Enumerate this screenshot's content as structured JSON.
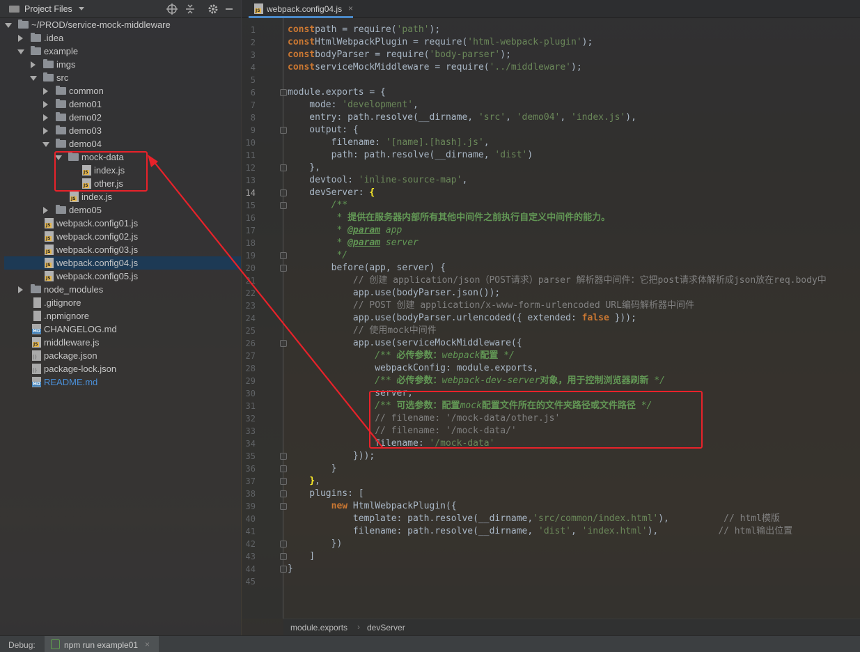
{
  "project_panel": {
    "title": "Project Files",
    "tree": [
      {
        "label": "~/PROD/service-mock-middleware",
        "type": "folder",
        "depth": 0,
        "state": "open"
      },
      {
        "label": ".idea",
        "type": "folder",
        "depth": 1,
        "state": "closed"
      },
      {
        "label": "example",
        "type": "folder",
        "depth": 1,
        "state": "open"
      },
      {
        "label": "imgs",
        "type": "folder",
        "depth": 2,
        "state": "closed"
      },
      {
        "label": "src",
        "type": "folder",
        "depth": 2,
        "state": "open"
      },
      {
        "label": "common",
        "type": "folder",
        "depth": 3,
        "state": "closed"
      },
      {
        "label": "demo01",
        "type": "folder",
        "depth": 3,
        "state": "closed"
      },
      {
        "label": "demo02",
        "type": "folder",
        "depth": 3,
        "state": "closed"
      },
      {
        "label": "demo03",
        "type": "folder",
        "depth": 3,
        "state": "closed"
      },
      {
        "label": "demo04",
        "type": "folder",
        "depth": 3,
        "state": "open"
      },
      {
        "label": "mock-data",
        "type": "folder",
        "depth": 4,
        "state": "open"
      },
      {
        "label": "index.js",
        "type": "js",
        "depth": 5
      },
      {
        "label": "other.js",
        "type": "js",
        "depth": 5
      },
      {
        "label": "index.js",
        "type": "js",
        "depth": 4
      },
      {
        "label": "demo05",
        "type": "folder",
        "depth": 3,
        "state": "closed"
      },
      {
        "label": "webpack.config01.js",
        "type": "js",
        "depth": 2
      },
      {
        "label": "webpack.config02.js",
        "type": "js",
        "depth": 2
      },
      {
        "label": "webpack.config03.js",
        "type": "js",
        "depth": 2
      },
      {
        "label": "webpack.config04.js",
        "type": "js",
        "depth": 2,
        "selected": true
      },
      {
        "label": "webpack.config05.js",
        "type": "js",
        "depth": 2
      },
      {
        "label": "node_modules",
        "type": "folder",
        "depth": 1,
        "state": "closed"
      },
      {
        "label": ".gitignore",
        "type": "file",
        "depth": 1
      },
      {
        "label": ".npmignore",
        "type": "file",
        "depth": 1
      },
      {
        "label": "CHANGELOG.md",
        "type": "md",
        "depth": 1
      },
      {
        "label": "middleware.js",
        "type": "js",
        "depth": 1
      },
      {
        "label": "package.json",
        "type": "json",
        "depth": 1
      },
      {
        "label": "package-lock.json",
        "type": "json",
        "depth": 1
      },
      {
        "label": "README.md",
        "type": "md",
        "depth": 1,
        "color": "#4a8fd8"
      }
    ]
  },
  "editor": {
    "tab": {
      "label": "webpack.config04.js"
    },
    "current_line": 14,
    "lines": [
      [
        [
          "kw",
          "const"
        ],
        [
          "",
          "path = require("
        ],
        [
          "str",
          "'path'"
        ],
        [
          "",
          ");"
        ]
      ],
      [
        [
          "kw",
          "const"
        ],
        [
          "",
          "HtmlWebpackPlugin = require("
        ],
        [
          "str",
          "'html-webpack-plugin'"
        ],
        [
          "",
          ");"
        ]
      ],
      [
        [
          "kw",
          "const"
        ],
        [
          "",
          "bodyParser = require("
        ],
        [
          "str",
          "'body-parser'"
        ],
        [
          "",
          ");"
        ]
      ],
      [
        [
          "kw",
          "const"
        ],
        [
          "",
          "serviceMockMiddleware = require("
        ],
        [
          "str",
          "'../middleware'"
        ],
        [
          "",
          ");"
        ]
      ],
      [],
      [
        [
          "",
          "module.exports = {"
        ]
      ],
      [
        [
          "",
          "    mode: "
        ],
        [
          "str",
          "'development'"
        ],
        [
          "",
          ","
        ]
      ],
      [
        [
          "",
          "    entry: path.resolve(__dirname, "
        ],
        [
          "str",
          "'src'"
        ],
        [
          "",
          ", "
        ],
        [
          "str",
          "'demo04'"
        ],
        [
          "",
          ", "
        ],
        [
          "str",
          "'index.js'"
        ],
        [
          "",
          "),"
        ]
      ],
      [
        [
          "",
          "    output: {"
        ]
      ],
      [
        [
          "",
          "        filename: "
        ],
        [
          "str",
          "'[name].[hash].js'"
        ],
        [
          "",
          ","
        ]
      ],
      [
        [
          "",
          "        path: path.resolve(__dirname, "
        ],
        [
          "str",
          "'dist'"
        ],
        [
          "",
          ")"
        ]
      ],
      [
        [
          "",
          "    },"
        ]
      ],
      [
        [
          "",
          "    devtool: "
        ],
        [
          "str",
          "'inline-source-map'"
        ],
        [
          "",
          ","
        ]
      ],
      [
        [
          "",
          "    devServer: "
        ],
        [
          "br",
          "{"
        ]
      ],
      [
        [
          "dc",
          "        /**"
        ]
      ],
      [
        [
          "dc",
          "         * "
        ],
        [
          "dcb",
          "提供在服务器内部所有其他中间件之前执行自定义中间件的能力。"
        ]
      ],
      [
        [
          "dc",
          "         * "
        ],
        [
          "dt",
          "@param"
        ],
        [
          "dc",
          " app"
        ]
      ],
      [
        [
          "dc",
          "         * "
        ],
        [
          "dt",
          "@param"
        ],
        [
          "dc",
          " server"
        ]
      ],
      [
        [
          "dc",
          "         */"
        ]
      ],
      [
        [
          "",
          "        before(app, server) {"
        ]
      ],
      [
        [
          "cm",
          "            // 创建 application/json（POST请求）parser 解析器中间件：它把post请求体解析成json放在req.body中"
        ]
      ],
      [
        [
          "",
          "            app.use(bodyParser.json());"
        ]
      ],
      [
        [
          "cm",
          "            // POST 创建 application/x-www-form-urlencoded URL编码解析器中间件"
        ]
      ],
      [
        [
          "",
          "            app.use(bodyParser.urlencoded({ extended: "
        ],
        [
          "kw",
          "false"
        ],
        [
          "",
          " }));"
        ]
      ],
      [
        [
          "cm",
          "            // 使用mock中间件"
        ]
      ],
      [
        [
          "",
          "            app.use(serviceMockMiddleware({"
        ]
      ],
      [
        [
          "dc",
          "                /** "
        ],
        [
          "dcb",
          "必传参数："
        ],
        [
          "dc",
          "webpack"
        ],
        [
          "dcb",
          "配置"
        ],
        [
          "dc",
          " */"
        ]
      ],
      [
        [
          "",
          "                webpackConfig: module.exports,"
        ]
      ],
      [
        [
          "dc",
          "                /** "
        ],
        [
          "dcb",
          "必传参数："
        ],
        [
          "dc",
          "webpack-dev-server"
        ],
        [
          "dcb",
          "对象，用于控制浏览器刷新"
        ],
        [
          "dc",
          " */"
        ]
      ],
      [
        [
          "",
          "                server,"
        ]
      ],
      [
        [
          "dc",
          "                /** "
        ],
        [
          "dcb",
          "可选参数：配置"
        ],
        [
          "dc",
          "mock"
        ],
        [
          "dcb",
          "配置文件所在的文件夹路径或文件路径"
        ],
        [
          "dc",
          " */"
        ]
      ],
      [
        [
          "cm",
          "                // filename: '/mock-data/other.js'"
        ]
      ],
      [
        [
          "cm",
          "                // filename: '/mock-data/'"
        ]
      ],
      [
        [
          "",
          "                filename: "
        ],
        [
          "str",
          "'/mock-data'"
        ]
      ],
      [
        [
          "",
          "            }));"
        ]
      ],
      [
        [
          "",
          "        }"
        ]
      ],
      [
        [
          "",
          "    "
        ],
        [
          "br",
          "}"
        ],
        [
          "",
          ","
        ]
      ],
      [
        [
          "",
          "    plugins: ["
        ]
      ],
      [
        [
          "",
          "        "
        ],
        [
          "kw",
          "new"
        ],
        [
          "",
          " HtmlWebpackPlugin({"
        ]
      ],
      [
        [
          "",
          "            template: path.resolve(__dirname,"
        ],
        [
          "str",
          "'src/common/index.html'"
        ],
        [
          "",
          "),          "
        ],
        [
          "cm",
          "// html模版"
        ]
      ],
      [
        [
          "",
          "            filename: path.resolve(__dirname, "
        ],
        [
          "str",
          "'dist'"
        ],
        [
          "",
          ", "
        ],
        [
          "str",
          "'index.html'"
        ],
        [
          "",
          "),           "
        ],
        [
          "cm",
          "// html输出位置"
        ]
      ],
      [
        [
          "",
          "        })"
        ]
      ],
      [
        [
          "",
          "    ]"
        ]
      ],
      [
        [
          "",
          "}"
        ]
      ],
      []
    ],
    "fold_lines": [
      6,
      9,
      12,
      14,
      15,
      19,
      20,
      26,
      35,
      36,
      37,
      38,
      39,
      42,
      43,
      44
    ]
  },
  "breadcrumb": {
    "items": [
      "module.exports",
      "devServer"
    ]
  },
  "bottom_bar": {
    "debug_label": "Debug:",
    "run_tab_label": "npm run example01",
    "run_tab_close": "×"
  }
}
